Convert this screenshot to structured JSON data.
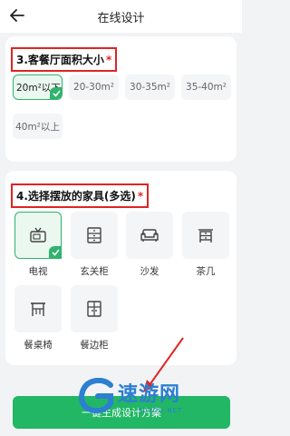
{
  "header": {
    "title": "在线设计"
  },
  "area_section": {
    "number": "3.",
    "title": "客餐厅面积大小",
    "required_mark": "*",
    "options": [
      {
        "label": "20m²以下",
        "selected": true
      },
      {
        "label": "20-30m²",
        "selected": false
      },
      {
        "label": "30-35m²",
        "selected": false
      },
      {
        "label": "35-40m²",
        "selected": false
      },
      {
        "label": "40m²以上",
        "selected": false
      }
    ]
  },
  "furniture_section": {
    "number": "4.",
    "title": "选择摆放的家具(多选)",
    "required_mark": "*",
    "items": [
      {
        "label": "电视",
        "icon": "tv-icon",
        "selected": true
      },
      {
        "label": "玄关柜",
        "icon": "cabinet-icon",
        "selected": false
      },
      {
        "label": "沙发",
        "icon": "sofa-icon",
        "selected": false
      },
      {
        "label": "茶几",
        "icon": "coffee-table-icon",
        "selected": false
      },
      {
        "label": "餐桌椅",
        "icon": "dining-table-icon",
        "selected": false
      },
      {
        "label": "餐边柜",
        "icon": "sideboard-icon",
        "selected": false
      }
    ]
  },
  "footer": {
    "generate_label": "一键生成设计方案"
  },
  "watermark": {
    "text": "速游网",
    "sub": "SUYOU.NET"
  },
  "colors": {
    "accent": "#21b765",
    "highlight": "#e02424"
  }
}
